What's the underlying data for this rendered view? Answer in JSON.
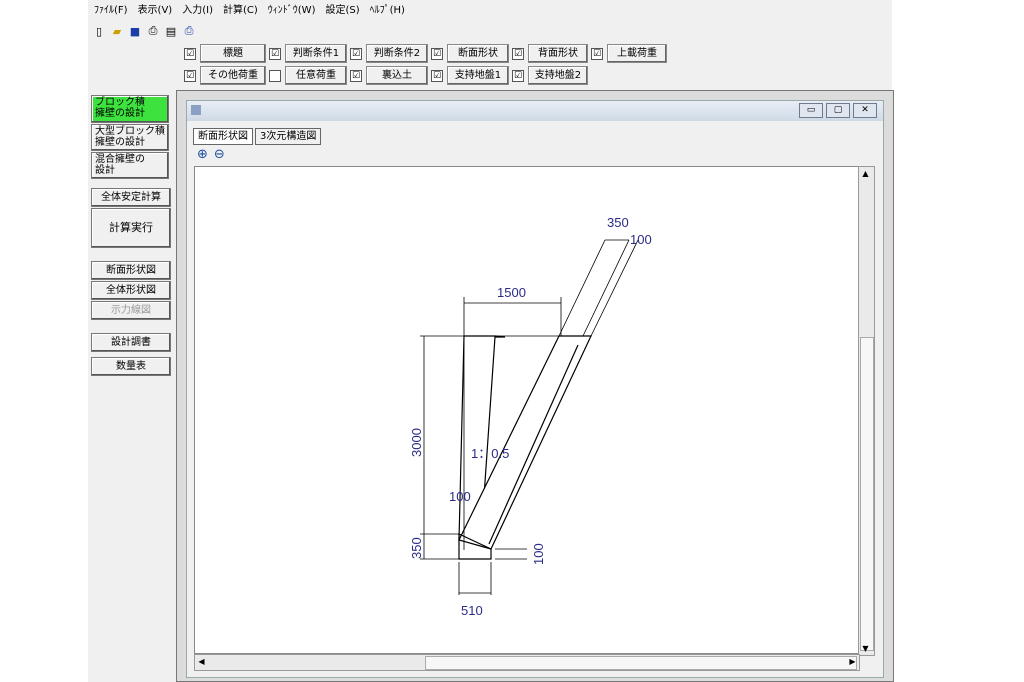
{
  "menu": [
    "ﾌｧｲﾙ(F)",
    "表示(V)",
    "入力(I)",
    "計算(C)",
    "ｳｨﾝﾄﾞｳ(W)",
    "設定(S)",
    "ﾍﾙﾌﾟ(H)"
  ],
  "checks_row1": [
    {
      "label": "標題",
      "checked": "☑"
    },
    {
      "label": "判断条件1",
      "checked": "☑"
    },
    {
      "label": "判断条件2",
      "checked": "☑"
    },
    {
      "label": "断面形状",
      "checked": "☑"
    },
    {
      "label": "背面形状",
      "checked": "☑"
    },
    {
      "label": "上載荷重",
      "checked": "☑"
    }
  ],
  "checks_row2": [
    {
      "label": "その他荷重",
      "checked": "☑"
    },
    {
      "label": "任意荷重",
      "checked": ""
    },
    {
      "label": "裏込土",
      "checked": "☑"
    },
    {
      "label": "支持地盤1",
      "checked": "☑"
    },
    {
      "label": "支持地盤2",
      "checked": "☑"
    }
  ],
  "side": {
    "block": "ブロック積\n擁壁の設計",
    "large": "大型ブロック積\n擁壁の設計",
    "mixed": "混合擁壁の\n設計",
    "stability": "全体安定計算",
    "run": "計算実行",
    "section": "断面形状図",
    "overall": "全体形状図",
    "force": "示力線図",
    "report": "設計調書",
    "quantity": "数量表"
  },
  "tabs": [
    "断面形状図",
    "3次元構造図"
  ],
  "dims": {
    "top_width": "350",
    "top_offset": "100",
    "horizontal": "1500",
    "height": "3000",
    "slope": "1：0.5",
    "back": "100",
    "base_h": "350",
    "base_right": "100",
    "base_w": "510"
  },
  "colors": {
    "dim": "#2b2b8a",
    "line": "#000000",
    "active": "#3ee23e"
  }
}
